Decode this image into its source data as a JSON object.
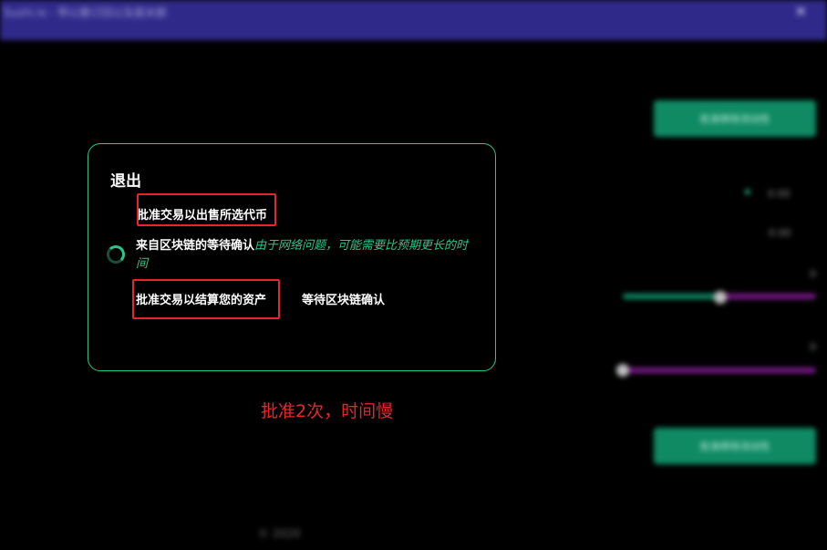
{
  "window": {
    "title": "Sushi.io - 带以撤订回以及报关额",
    "close_glyph": "✕"
  },
  "background": {
    "button_top_label": "批准移除流动性",
    "button_bottom_label": "批准移除流动性",
    "stat_label_1": "0.00",
    "stat_label_2": "0.00",
    "amount_1": "0",
    "amount_2": "0",
    "footer": "© 2020"
  },
  "modal": {
    "title": "退出",
    "step1_label": "批准交易以出售所选代币",
    "step2_label": "来自区块链的等待确认",
    "step2_note": "由于网络问题，可能需要比预期更长的时间",
    "step3_label": "批准交易以结算您的资产",
    "step3_status": "等待区块链确认"
  },
  "annotation": {
    "text": "批准2次，时间慢"
  },
  "colors": {
    "accent": "#26c98a",
    "annotation_red": "#e8262a",
    "topbar": "#2f2a8a",
    "slider_green": "#0f8a63",
    "slider_purple": "#7a1a8a"
  },
  "sliders": {
    "slider1_level": 0.5,
    "slider2_level": 0.0
  }
}
